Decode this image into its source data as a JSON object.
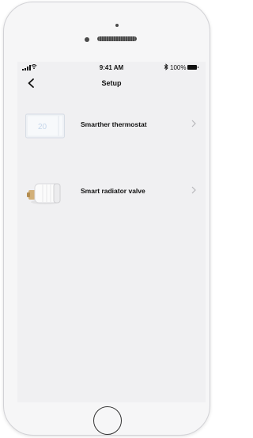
{
  "status_bar": {
    "time": "9:41 AM",
    "battery_percent": "100%",
    "bluetooth_icon": "bluetooth-icon",
    "signal_icon": "signal-icon",
    "wifi_icon": "wifi-icon"
  },
  "nav": {
    "title": "Setup",
    "back_icon": "chevron-left-icon"
  },
  "items": [
    {
      "label": "Smarther thermostat",
      "icon": "thermostat-icon",
      "display_value": "20",
      "chevron": "chevron-right-icon"
    },
    {
      "label": "Smart radiator valve",
      "icon": "radiator-valve-icon",
      "chevron": "chevron-right-icon"
    }
  ],
  "colors": {
    "screen_bg": "#f0f0f2",
    "text": "#111111",
    "chevron": "#b8b8bc"
  }
}
